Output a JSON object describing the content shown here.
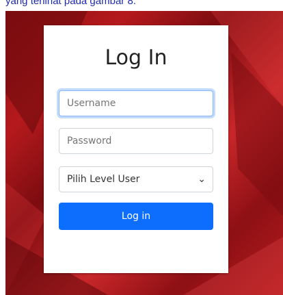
{
  "caption": "yang terlihat pada gambar 8.",
  "login": {
    "title": "Log In",
    "username_placeholder": "Username",
    "password_placeholder": "Password",
    "level_selected": "Pilih Level User",
    "submit_label": "Log in"
  },
  "colors": {
    "background": "#a8151a",
    "button": "#0d6efd",
    "caption_text": "#1d2bb0"
  },
  "icons": {
    "select_arrow": "chevron-down-icon"
  }
}
